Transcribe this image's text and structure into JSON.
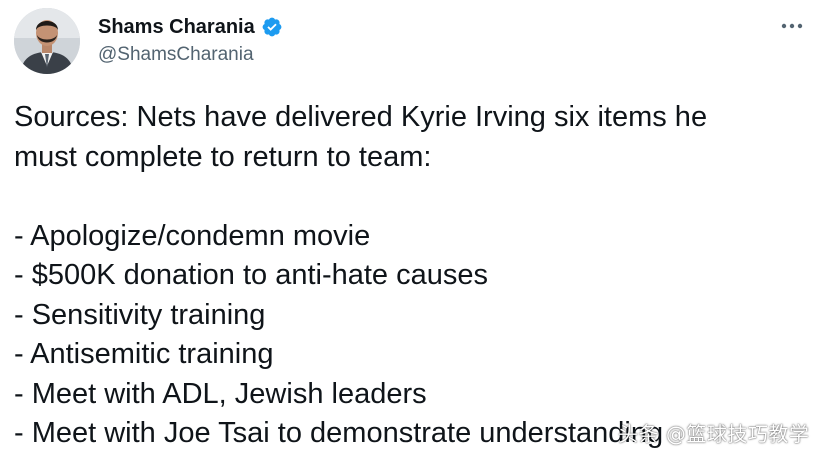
{
  "author": {
    "display_name": "Shams Charania",
    "handle": "@ShamsCharania",
    "verified": true,
    "verified_color": "#1d9bf0"
  },
  "tweet": {
    "intro_line_1": "Sources: Nets have delivered Kyrie Irving six items he",
    "intro_line_2": "must complete to return to team:",
    "items": [
      "- Apologize/condemn movie",
      "- $500K donation to anti-hate causes",
      "- Sensitivity training",
      "- Antisemitic training",
      "- Meet with ADL, Jewish leaders",
      "- Meet with Joe Tsai to demonstrate understanding"
    ]
  },
  "watermark": {
    "text": "头条 @篮球技巧教学"
  },
  "icons": {
    "more": "more-horizontal-icon",
    "verified": "verified-badge-icon"
  },
  "colors": {
    "text_primary": "#0f1419",
    "text_secondary": "#536471",
    "background": "#ffffff"
  }
}
